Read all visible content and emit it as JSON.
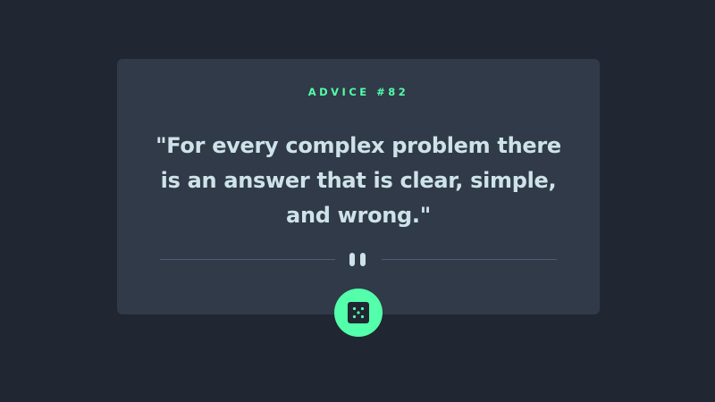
{
  "advice": {
    "label": "ADVICE #82",
    "quote": "\"For every complex problem there is an answer that is clear, simple, and wrong.\""
  },
  "icons": {
    "divider": "pause-icon",
    "button": "dice-icon"
  },
  "colors": {
    "background": "#202632",
    "card": "#313a48",
    "accent": "#53ffaa",
    "text": "#cee3e9",
    "divider": "#4f5d74"
  }
}
